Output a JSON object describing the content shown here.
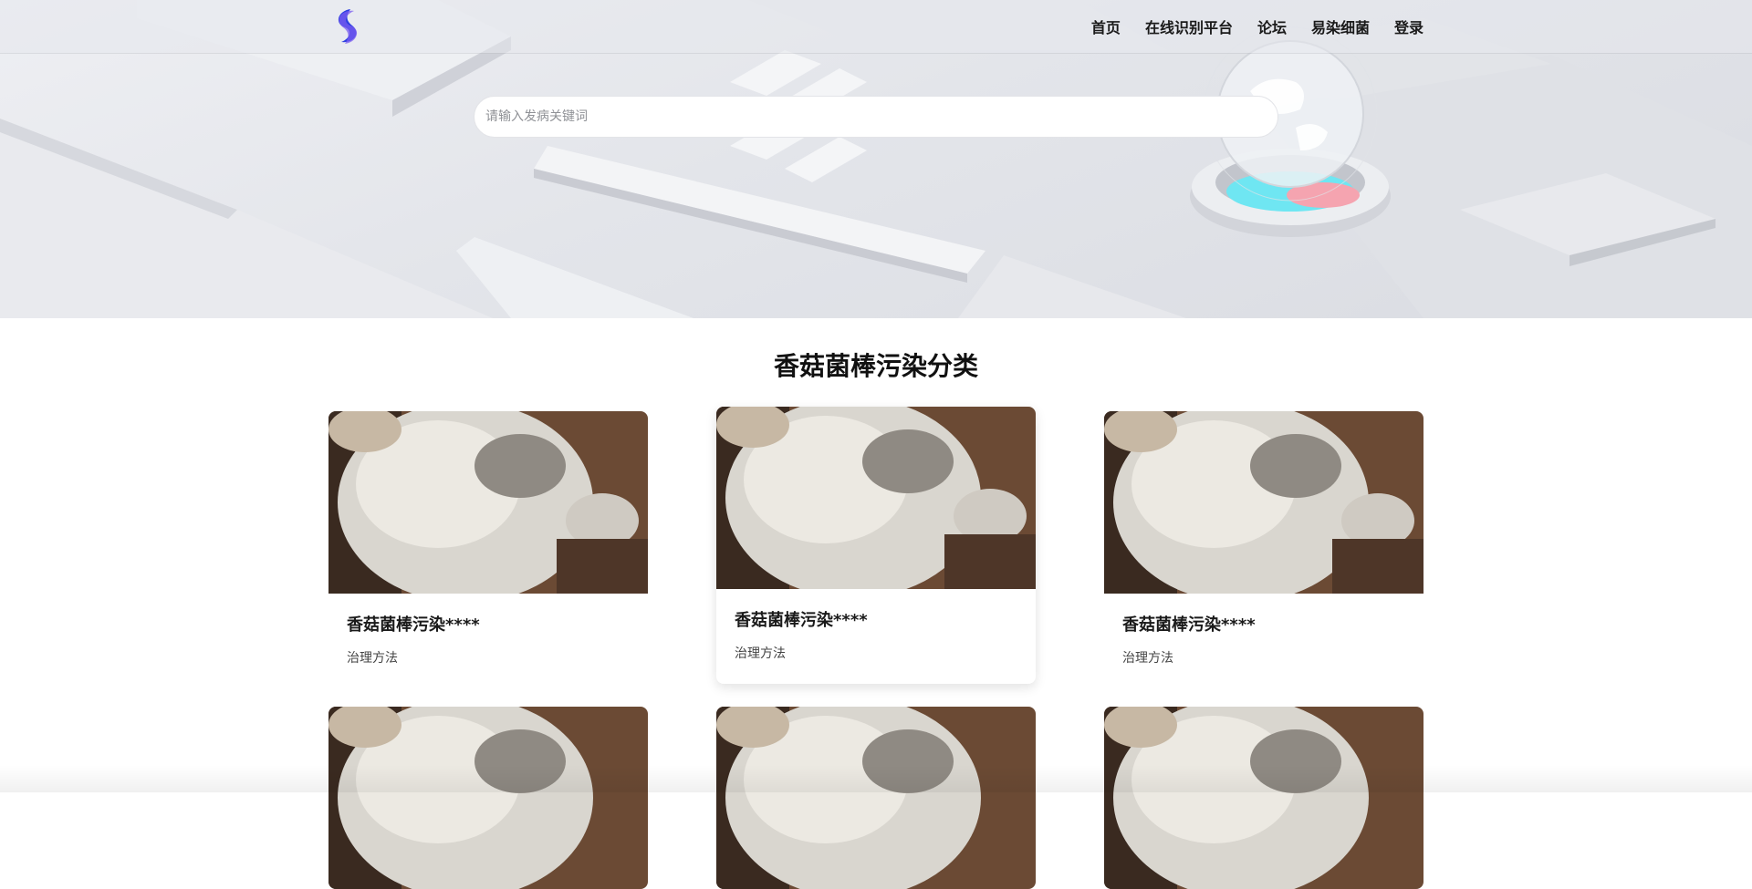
{
  "nav": {
    "items": [
      {
        "label": "首页"
      },
      {
        "label": "在线识别平台"
      },
      {
        "label": "论坛"
      },
      {
        "label": "易染细菌"
      },
      {
        "label": "登录"
      }
    ]
  },
  "search": {
    "placeholder": "请输入发病关键词",
    "value": ""
  },
  "section": {
    "title": "香菇菌棒污染分类"
  },
  "cards": [
    {
      "title": "香菇菌棒污染****",
      "subtitle": "治理方法"
    },
    {
      "title": "香菇菌棒污染****",
      "subtitle": "治理方法"
    },
    {
      "title": "香菇菌棒污染****",
      "subtitle": "治理方法"
    },
    {
      "title": "",
      "subtitle": ""
    },
    {
      "title": "",
      "subtitle": ""
    },
    {
      "title": "",
      "subtitle": ""
    }
  ],
  "icons": {
    "logo": "swirl-logo-icon"
  },
  "colors": {
    "logo_primary": "#2d3fe0",
    "logo_secondary": "#7a5cf0",
    "hero_bg": "#e6e7ec"
  }
}
